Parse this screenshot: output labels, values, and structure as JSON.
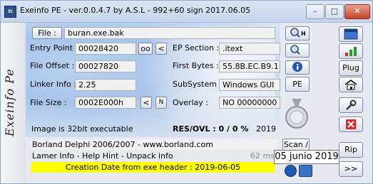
{
  "title_bar": {
    "icon": "EI",
    "title": "Exeinfo PE - ver.0.0.4.7  by A.S.L -  992+60 sign  2017.06.05",
    "min": "–",
    "max": "□",
    "close": "✕"
  },
  "side": {
    "text": "Exeinfo  Pe"
  },
  "file": {
    "button": "File :",
    "value": "buran.exe.bak"
  },
  "entry_point": {
    "label": "Entry Point :",
    "value": "00028420",
    "btn1": "oo",
    "btn2": "<"
  },
  "ep_section": {
    "label": "EP Section :",
    "value": ".itext"
  },
  "file_offset": {
    "label": "File Offset :",
    "value": "00027820"
  },
  "first_bytes": {
    "label": "First Bytes :",
    "value": "55.8B.EC.B9.11"
  },
  "linker_info": {
    "label": "Linker Info :",
    "value": "2.25"
  },
  "subsystem": {
    "label": "SubSystem :",
    "value": "Windows GUI"
  },
  "file_size": {
    "label": "File Size :",
    "value": "0002E000h",
    "btn1": "<",
    "btn2": "N"
  },
  "overlay": {
    "label": "Overlay :",
    "value": "NO  00000000"
  },
  "pe_button": "PE",
  "image_info": "Image is 32bit executable",
  "res_ovl": "RES/OVL : 0 / 0 %",
  "year": "2019",
  "info_lines": {
    "line1": "Borland Delphi 2006/2007 - www.borland.com",
    "line2": "Lamer Info - Help Hint - Unpack info",
    "line3": "Creation Date from exe header : 2019-06-05",
    "ms": "62 ms."
  },
  "scan_button": "Scan / t",
  "tooltip": "05 junio 2019",
  "right_buttons": {
    "h": "H",
    "plug": "Plug",
    "rip": "Rip",
    "next": ">>"
  },
  "colors": {
    "accent": "#2c4f8f",
    "highlight": "#ffff00"
  }
}
